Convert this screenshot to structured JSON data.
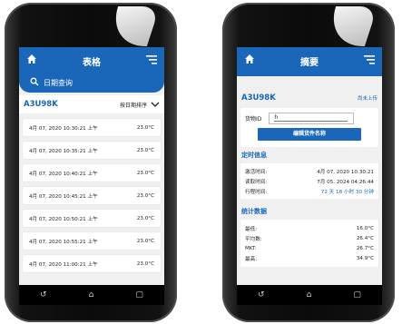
{
  "left_screen": {
    "title": "表格",
    "search_label": "日期查询",
    "device_id": "A3U98K",
    "sort_label": "按日期排序",
    "rows": [
      {
        "time": "4月 07, 2020 10:30:21 上午",
        "temp": "23.0°C"
      },
      {
        "time": "4月 07, 2020 10:35:21 上午",
        "temp": "23.0°C"
      },
      {
        "time": "4月 07, 2020 10:40:21 上午",
        "temp": "23.0°C"
      },
      {
        "time": "4月 07, 2020 10:45:21 上午",
        "temp": "23.0°C"
      },
      {
        "time": "4月 07, 2020 10:50:21 上午",
        "temp": "23.0°C"
      },
      {
        "time": "4月 07, 2020 10:55:21 上午",
        "temp": "23.0°C"
      },
      {
        "time": "4月 07, 2020 11:00:21 上午",
        "temp": "23.0°C"
      }
    ]
  },
  "right_screen": {
    "title": "摘要",
    "device_id": "A3U98K",
    "upload_link": "尚未上传",
    "goods_label": "货物ID",
    "goods_value": "h",
    "edit_button": "编辑货件名称",
    "timing_section": "定时信息",
    "timing": [
      {
        "label": "激活时间:",
        "value": "4月 07, 2020 10:30:21"
      },
      {
        "label": "读取时间:",
        "value": "7月 05, 2024 04:26:44"
      },
      {
        "label": "行程时间:",
        "value": "72 天 18 小时 30 分钟"
      }
    ],
    "stats_section": "统计数据",
    "stats": [
      {
        "label": "最低:",
        "value": "16.0°C"
      },
      {
        "label": "平均数:",
        "value": "26.4°C"
      },
      {
        "label": "MKT:",
        "value": "26.7°C"
      },
      {
        "label": "最高:",
        "value": "34.9°C"
      }
    ]
  },
  "nav": {
    "back": "↺",
    "home": "⌂",
    "recent": "▢"
  },
  "colors": {
    "accent": "#1a66b8",
    "background": "#f0f0f0"
  }
}
